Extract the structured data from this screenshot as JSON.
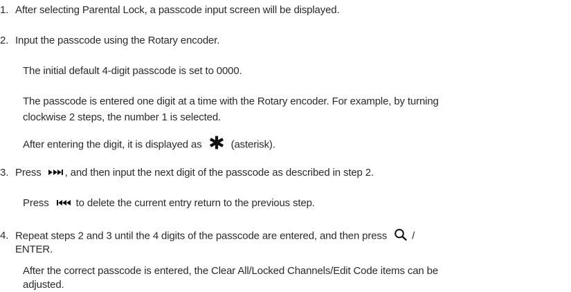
{
  "steps": [
    {
      "number": "1.",
      "text": "After selecting Parental Lock, a passcode input screen will be displayed."
    },
    {
      "number": "2.",
      "text": "Input the passcode using the Rotary encoder.",
      "notes": {
        "default_code": "The initial default 4-digit passcode is set to 0000.",
        "entry_line1": "The passcode is entered one digit at a time with the Rotary encoder. For example, by turning",
        "entry_line2": "clockwise 2 steps, the number 1 is selected.",
        "asterisk_before": "After entering the digit, it is displayed as",
        "asterisk_after": "(asterisk)."
      }
    },
    {
      "number": "3.",
      "text_before": "Press",
      "text_after": ", and then input the next digit of the passcode as described in step 2.",
      "note_before": "Press",
      "note_after": "to delete the current entry return to the previous step."
    },
    {
      "number": "4.",
      "text_line1": "Repeat steps 2 and 3 until the 4 digits of the passcode are entered, and then press",
      "text_line1_end": "/",
      "text_line2": "ENTER.",
      "note_line1": "After the correct passcode is entered, the Clear All/Locked Channels/Edit Code items can be",
      "note_line2": "adjusted."
    }
  ],
  "icons": {
    "asterisk": "asterisk-icon",
    "skip_forward": "skip-forward-icon",
    "skip_back": "skip-back-icon",
    "search": "search-icon"
  }
}
